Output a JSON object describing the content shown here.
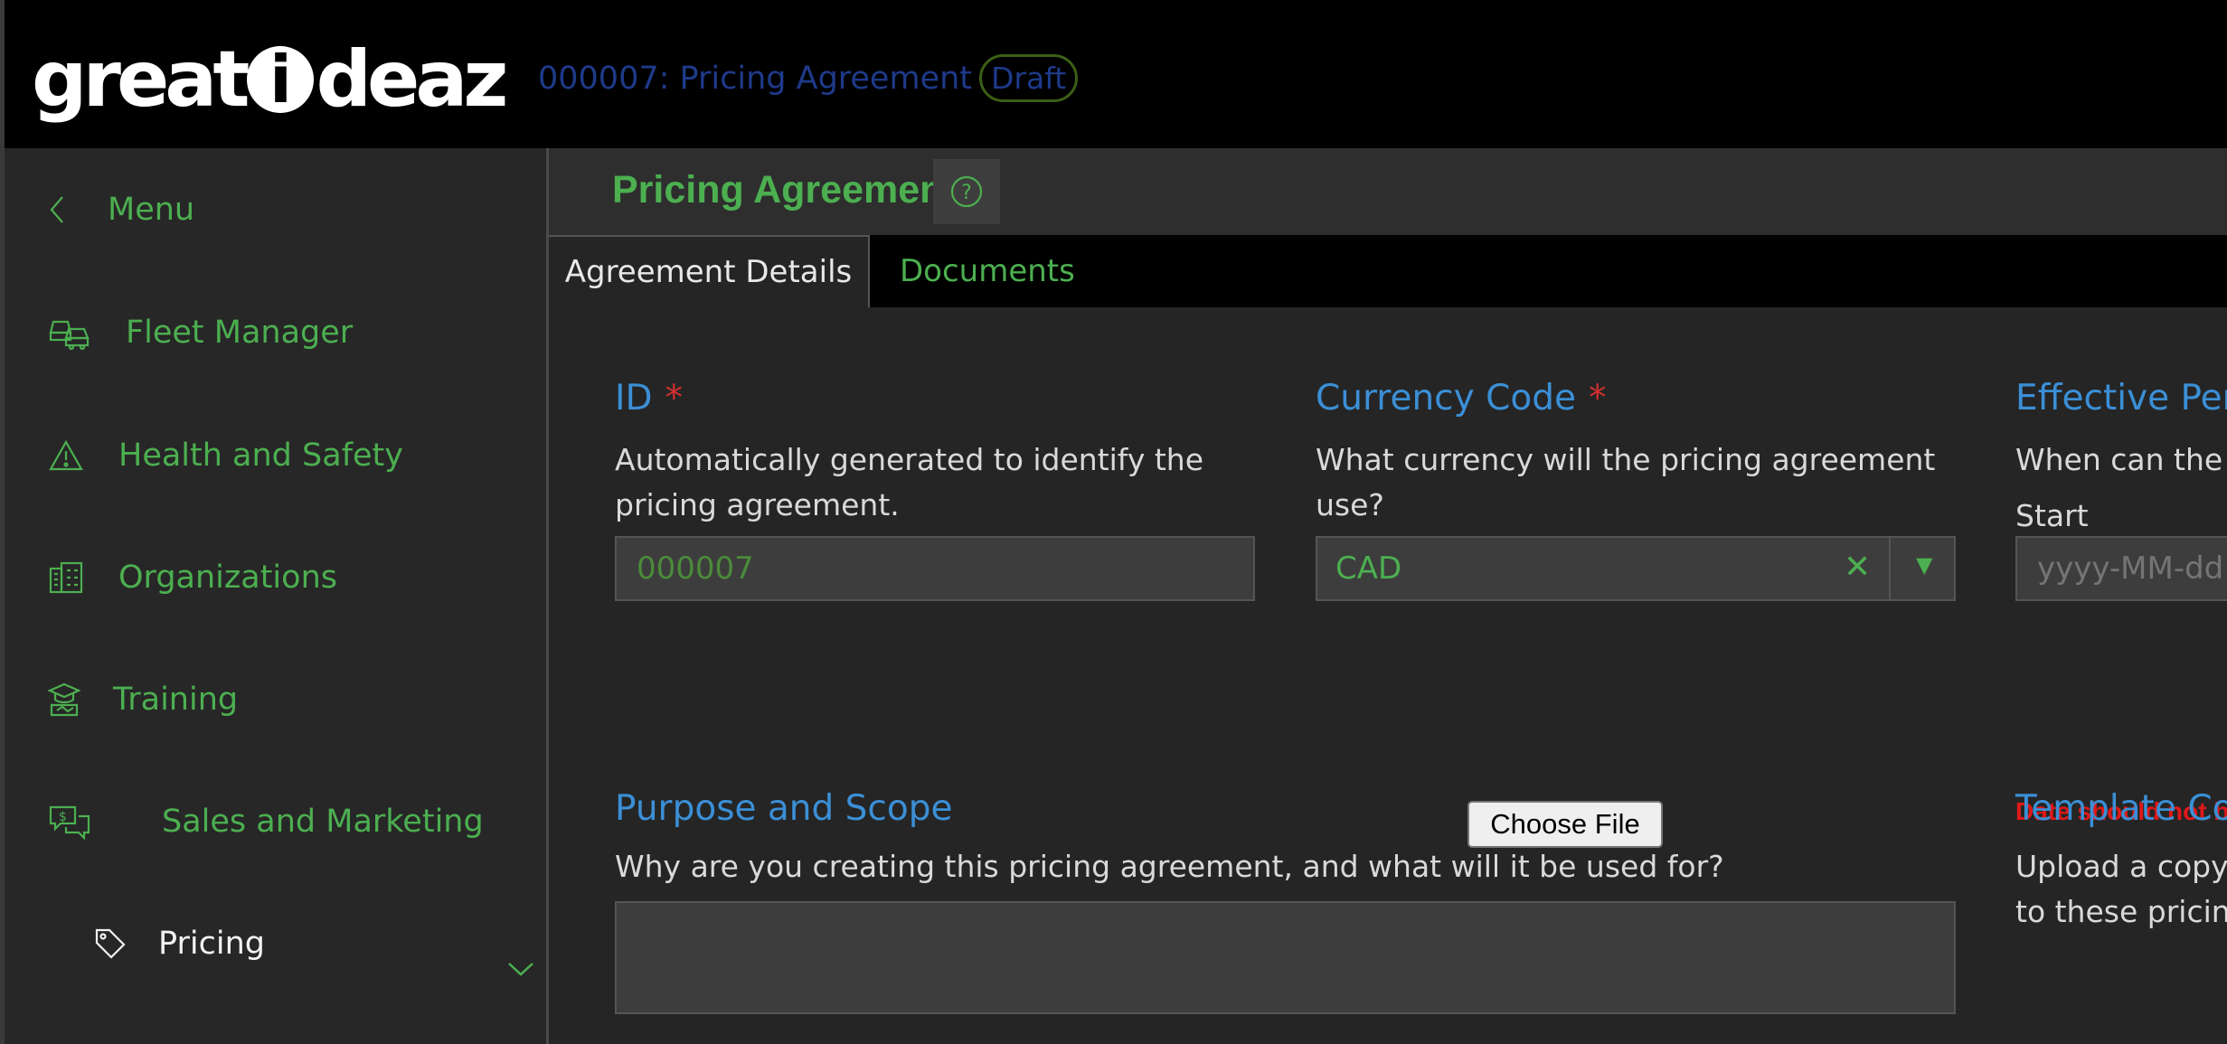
{
  "header": {
    "logo_text_left": "great",
    "logo_i": "i",
    "logo_text_right": "deaz",
    "doc_title": "000007: Pricing Agreement",
    "status": "Draft"
  },
  "sidebar": {
    "back_label": "Menu",
    "items": [
      {
        "label": "Fleet Manager",
        "icon": "vehicles-icon"
      },
      {
        "label": "Health and Safety",
        "icon": "warning-icon"
      },
      {
        "label": "Organizations",
        "icon": "building-icon"
      },
      {
        "label": "Training",
        "icon": "graduation-icon"
      },
      {
        "label": "Sales and Marketing",
        "icon": "sales-chat-icon"
      },
      {
        "label": "Pricing",
        "icon": "tag-icon"
      }
    ]
  },
  "main": {
    "page_title": "Pricing Agreement",
    "help_icon": "?",
    "tabs": [
      {
        "label": "Agreement Details",
        "active": true
      },
      {
        "label": "Documents",
        "active": false
      }
    ],
    "fields": {
      "id": {
        "label": "ID",
        "required_mark": "*",
        "help": "Automatically generated to identify the pricing agreement.",
        "value": "000007"
      },
      "currency": {
        "label": "Currency Code",
        "required_mark": "*",
        "help": "What currency will the pricing agreement use?",
        "value": "CAD",
        "clear_glyph": "✕",
        "dropdown_glyph": "▼"
      },
      "effective": {
        "label": "Effective Peri",
        "help": "When can the p",
        "start_label": "Start",
        "start_placeholder": "yyyy-MM-dd",
        "error": "Date should not b"
      },
      "purpose": {
        "label": "Purpose and Scope",
        "help": "Why are you creating this pricing agreement, and what will it be used for?",
        "value": ""
      },
      "template": {
        "label": "Template Cor",
        "help_line1": "Upload a copy",
        "help_line2": "to these pricing",
        "button": "Choose File"
      }
    }
  },
  "colors": {
    "accent_green": "#4caf50",
    "label_blue": "#3b8fd6",
    "error_red": "#e01818",
    "header_title": "#1e3a8a"
  }
}
